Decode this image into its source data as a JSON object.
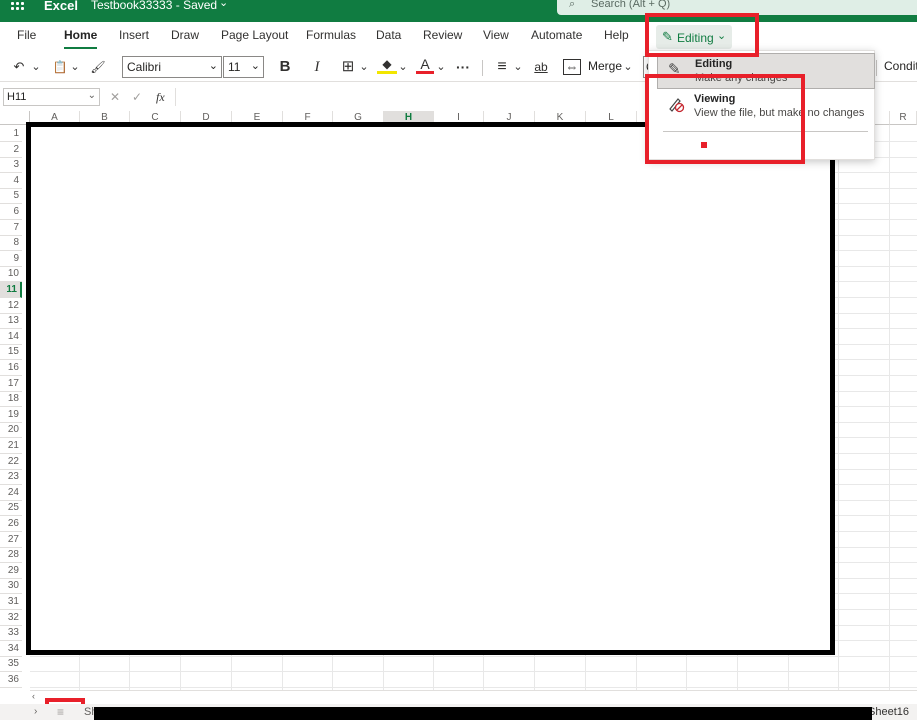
{
  "titlebar": {
    "app_name": "Excel",
    "doc_title": "Testbook33333 - Saved",
    "doc_chevron": "⌄",
    "search_icon": "⌕",
    "search_placeholder": "Search (Alt + Q)",
    "color": "#107c41"
  },
  "ribbon": {
    "tabs": [
      "File",
      "Home",
      "Insert",
      "Draw",
      "Page Layout",
      "Formulas",
      "Data",
      "Review",
      "View",
      "Automate",
      "Help"
    ],
    "active_tab": "Home",
    "mode_button": {
      "icon": "pencil-icon",
      "label": "Editing",
      "chevron": "⌄"
    }
  },
  "toolbar": {
    "undo_icon": "↶",
    "paste_icon": "📋",
    "format_painter_icon": "🖌",
    "font_name": "Calibri",
    "font_size": "11",
    "bold": "B",
    "italic": "I",
    "borders_icon": "⊞",
    "fill_icon": "◆",
    "font_color_icon": "A",
    "more": "···",
    "align_icon": "≡",
    "wrap_icon": "ab",
    "merge_icon": "⇔",
    "merge_label": "Merge",
    "general_partial": "G",
    "conditional_label": "Conditi",
    "dropdown_glyph": "⌄"
  },
  "formula_bar": {
    "name_box": "H11",
    "cancel_icon": "✕",
    "confirm_icon": "✓",
    "fx_icon": "fx",
    "value": ""
  },
  "grid": {
    "columns": [
      "A",
      "B",
      "C",
      "D",
      "E",
      "F",
      "G",
      "H",
      "I",
      "J",
      "K",
      "L",
      "M",
      "N",
      "O",
      "P",
      "Q",
      "R"
    ],
    "selected_column": "H",
    "rows": [
      "1",
      "2",
      "3",
      "4",
      "5",
      "6",
      "7",
      "8",
      "9",
      "10",
      "11",
      "12",
      "13",
      "14",
      "15",
      "16",
      "17",
      "18",
      "19",
      "20",
      "21",
      "22",
      "23",
      "24",
      "25",
      "26",
      "27",
      "28",
      "29",
      "30",
      "31",
      "32",
      "33",
      "34",
      "35",
      "36"
    ],
    "selected_row": "11"
  },
  "mode_menu": {
    "items": [
      {
        "icon": "pencil-icon",
        "title": "Editing",
        "description": "Make any changes"
      },
      {
        "icon": "no-edit-icon",
        "title": "Viewing",
        "description": "View the file, but make no changes"
      }
    ]
  },
  "sheets": {
    "nav_left": "‹",
    "nav_right": "›",
    "all_sheets_icon": "≡",
    "first_visible": "Sh",
    "last_visible": "Sheet16"
  },
  "colors": {
    "accent": "#107c41",
    "highlight": "#e8202a",
    "redaction": "#000000"
  }
}
